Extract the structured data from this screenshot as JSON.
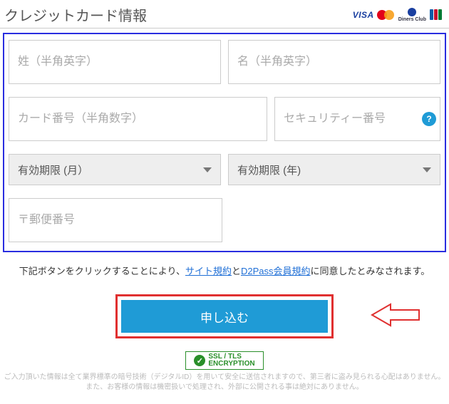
{
  "header": {
    "title": "クレジットカード情報",
    "logos": [
      "VISA",
      "MasterCard",
      "Diners Club",
      "JCB"
    ]
  },
  "form": {
    "lastname_ph": "姓（半角英字）",
    "firstname_ph": "名（半角英字）",
    "cardnum_ph": "カード番号（半角数字）",
    "security_ph": "セキュリティー番号",
    "exp_month_label": "有効期限 (月）",
    "exp_year_label": "有効期限 (年)",
    "postal_ph": "〒郵便番号",
    "help_symbol": "?"
  },
  "consent": {
    "before": "下記ボタンをクリックすることにより、",
    "link1": "サイト規約",
    "mid": "と",
    "link2": "D2Pass会員規約",
    "after": "に同意したとみなされます。"
  },
  "submit": {
    "label": "申し込む"
  },
  "ssl": {
    "line1": "SSL / TLS",
    "line2": "ENCRYPTION"
  },
  "footnote": "ご入力頂いた情報は全て業界標準の暗号技術（デジタルID）を用いて安全に送信されますので、第三者に盗み見られる心配はありません。また、お客様の情報は機密扱いで処理され、外部に公開される事は絶対にありません。"
}
